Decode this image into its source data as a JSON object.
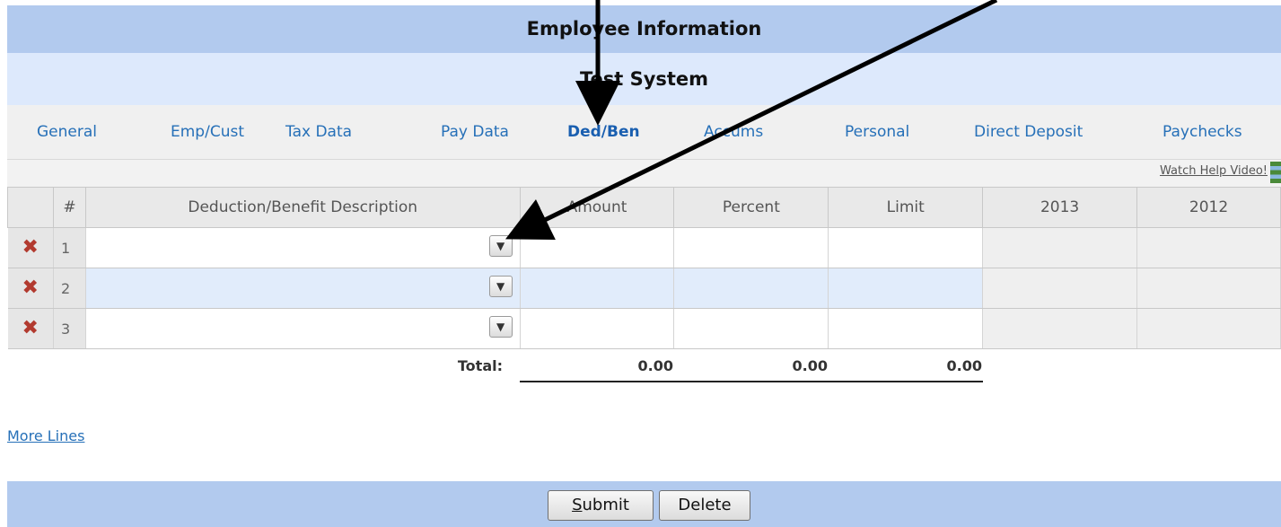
{
  "header": {
    "title": "Employee Information",
    "subtitle": "Test System"
  },
  "tabs": [
    {
      "label": "General",
      "active": false
    },
    {
      "label": "Emp/Cust",
      "active": false
    },
    {
      "label": "Tax Data",
      "active": false
    },
    {
      "label": "Pay Data",
      "active": false
    },
    {
      "label": "Ded/Ben",
      "active": true
    },
    {
      "label": "Accums",
      "active": false
    },
    {
      "label": "Personal",
      "active": false
    },
    {
      "label": "Direct Deposit",
      "active": false
    },
    {
      "label": "Paychecks",
      "active": false
    }
  ],
  "help": {
    "link": "Watch Help Video!",
    "icon": "film-icon"
  },
  "table": {
    "columns": {
      "num": "#",
      "description": "Deduction/Benefit Description",
      "amount": "Amount",
      "percent": "Percent",
      "limit": "Limit",
      "year1": "2013",
      "year2": "2012"
    },
    "rows": [
      {
        "num": "1",
        "delete_icon": "close-icon",
        "dropdown_icon": "chevron-down-icon"
      },
      {
        "num": "2",
        "delete_icon": "close-icon",
        "dropdown_icon": "chevron-down-icon"
      },
      {
        "num": "3",
        "delete_icon": "close-icon",
        "dropdown_icon": "chevron-down-icon"
      }
    ]
  },
  "totals": {
    "label": "Total:",
    "amount": "0.00",
    "percent": "0.00",
    "limit": "0.00"
  },
  "more_lines": "More Lines",
  "buttons": {
    "submit": "ubmit",
    "submit_mnemonic": "S",
    "delete": "Delete"
  },
  "colors": {
    "header_bg": "#b2caee",
    "subheader_bg": "#dde9fc",
    "link": "#2670b8",
    "delete_x": "#b23a2f"
  }
}
